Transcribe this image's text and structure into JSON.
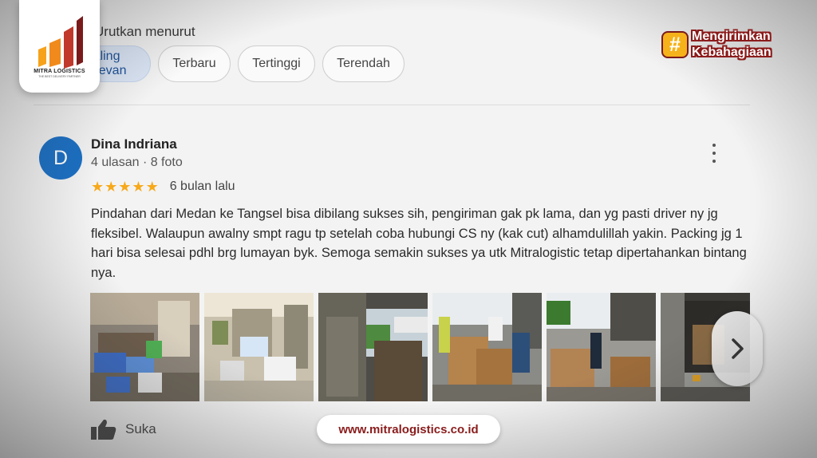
{
  "sort": {
    "label": "Urutkan menurut",
    "chips": [
      {
        "label": "Paling relevan",
        "active": true
      },
      {
        "label": "Terbaru",
        "active": false
      },
      {
        "label": "Tertinggi",
        "active": false
      },
      {
        "label": "Terendah",
        "active": false
      }
    ]
  },
  "review": {
    "avatar_letter": "D",
    "name": "Dina Indriana",
    "meta": "4 ulasan · 8 foto",
    "rating": 5,
    "time": "6 bulan lalu",
    "text": "Pindahan dari Medan ke Tangsel bisa dibilang sukses sih, pengiriman gak pk lama, dan yg pasti driver ny jg fleksibel. Walaupun awalny smpt ragu tp setelah coba hubungi CS ny (kak cut) alhamdulillah yakin. Packing jg 1 hari bisa selesai pdhl brg lumayan byk. Semoga semakin sukses ya utk Mitralogistic tetap dipertahankan bintang nya.",
    "photos": [
      {
        "name": "photo-boxes-room"
      },
      {
        "name": "photo-boxes-hallway"
      },
      {
        "name": "photo-warehouse-door"
      },
      {
        "name": "photo-workers-crates"
      },
      {
        "name": "photo-crates-yard"
      },
      {
        "name": "photo-truck-loading"
      }
    ],
    "like_label": "Suka"
  },
  "brand": {
    "logo_name": "MITRA LOGISTICS",
    "logo_tagline": "THE BEST DELIVERY PARTNER",
    "hashtag_line1": "Mengirimkan",
    "hashtag_line2": "Kebahagiaan",
    "hashtag_symbol": "#",
    "website": "www.mitralogistics.co.id"
  },
  "colors": {
    "accent": "#1a6fc4",
    "star": "#f7a91a",
    "brand_orange": "#f6b21a",
    "brand_maroon": "#8a1c1c"
  }
}
